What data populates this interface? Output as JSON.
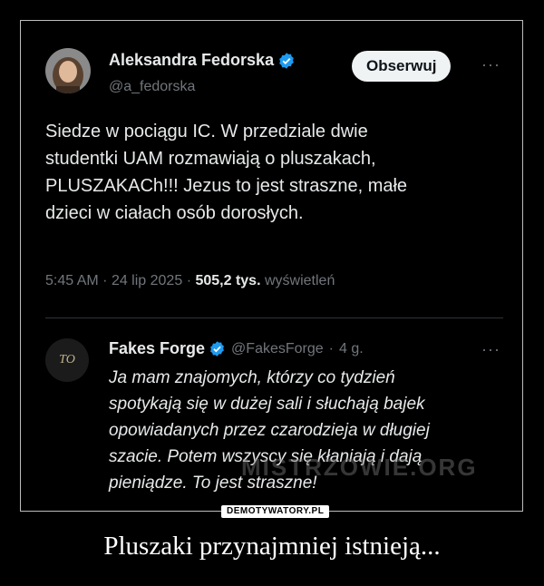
{
  "tweet": {
    "author_name": "Aleksandra Fedorska",
    "author_handle": "@a_fedorska",
    "follow_label": "Obserwuj",
    "more_label": "···",
    "text": "Siedze w pociągu IC. W przedziale dwie\nstudentki UAM rozmawiają o pluszakach,\nPLUSZAKACh!!! Jezus to jest straszne, małe\ndzieci w ciałach osób dorosłych.",
    "time": "5:45 AM",
    "date": "24 lip 2025",
    "views_count": "505,2 tys.",
    "views_label": "wyświetleń",
    "separator": "·"
  },
  "reply": {
    "author_name": "Fakes Forge",
    "author_handle": "@FakesForge",
    "age": "4 g.",
    "more_label": "···",
    "avatar_text": "TO",
    "text": "Ja mam znajomych, którzy co tydzień\nspotykają się w dużej sali i słuchają bajek\nopowiadanych przez czarodzieja w długiej\nszacie. Potem wszyscy się kłaniają i dają\npieniądze. To jest straszne!"
  },
  "overlay": {
    "watermark_text": "MISTRZOWIE.ORG",
    "site_logo": "DEMOTYWATORY.PL"
  },
  "caption": "Pluszaki przynajmniej istnieją...",
  "colors": {
    "background": "#000000",
    "verified_blue": "#1d9bf0",
    "muted_text": "#71767b"
  }
}
